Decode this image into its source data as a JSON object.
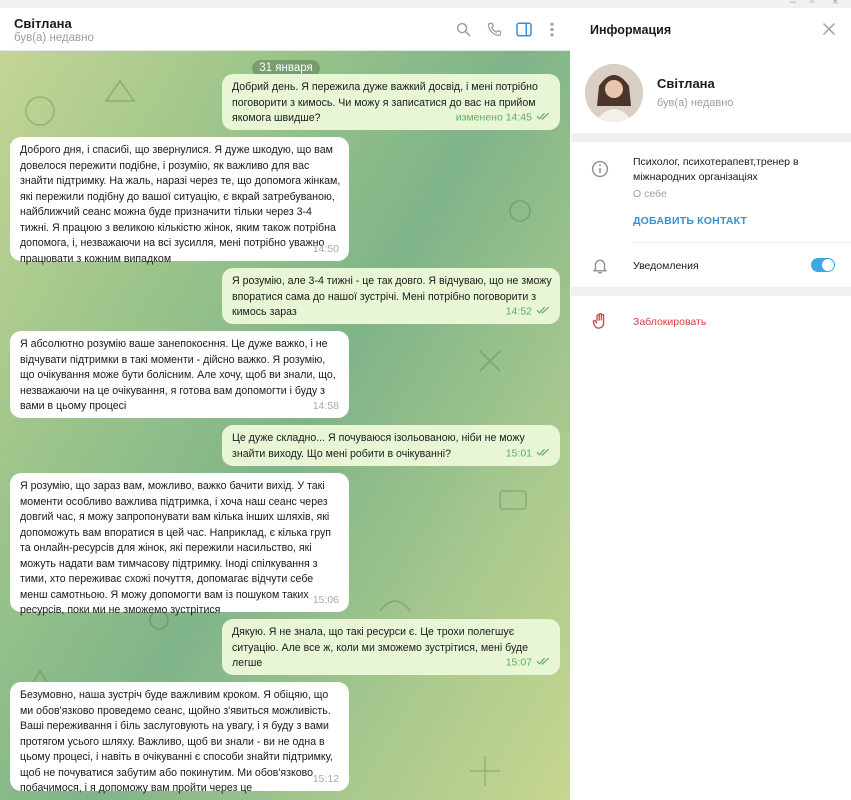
{
  "chat": {
    "contact_name": "Світлана",
    "contact_status": "був(а) недавно",
    "date_label": "31 января",
    "messages": [
      {
        "dir": "out",
        "text": "Добрий день. Я пережила дуже важкий досвід, і мені потрібно поговорити з кимось. Чи можу я записатися до вас на прийом якомога швидше?",
        "time": "изменено 14:45",
        "read": true
      },
      {
        "dir": "in",
        "text": "Доброго дня, і спасибі, що звернулися. Я дуже шкодую, що вам довелося пережити подібне, і розумію, як важливо для вас знайти підтримку. На жаль, наразі через те, що допомога жінкам, які пережили подібну до вашої ситуацію, є вкрай затребуваною, найближчий сеанс можна буде призначити тільки через 3-4 тижні. Я працюю з великою кількістю жінок, яким також потрібна допомога, і, незважаючи на всі зусилля, мені потрібно уважно працювати з кожним випадком",
        "time": "14:50"
      },
      {
        "dir": "out",
        "text": "Я розумію, але 3-4 тижні - це так довго. Я відчуваю, що не зможу впоратися сама до нашої зустрічі. Мені потрібно поговорити з кимось зараз",
        "time": "14:52",
        "read": true
      },
      {
        "dir": "in",
        "text": "Я абсолютно розумію ваше занепокоєння. Це дуже важко, і не відчувати підтримки в такі моменти - дійсно важко. Я розумію, що очікування може бути болісним. Але хочу, щоб ви знали, що, незважаючи на це очікування, я готова вам допомогти і буду з вами в цьому процесі",
        "time": "14:58"
      },
      {
        "dir": "out",
        "text": "Це дуже складно... Я почуваюся ізольованою, ніби не можу знайти виходу. Що мені робити в очікуванні?",
        "time": "15:01",
        "read": true
      },
      {
        "dir": "in",
        "text": "Я розумію, що зараз вам, можливо, важко бачити вихід. У такі моменти особливо важлива підтримка, і хоча наш сеанс через довгий час, я можу запропонувати вам кілька інших шляхів, які допоможуть вам впоратися в цей час. Наприклад, є кілька груп та онлайн-ресурсів для жінок, які пережили насильство, які можуть надати вам тимчасову підтримку. Іноді спілкування з тими, хто переживає схожі почуття, допомагає відчути себе менш самотньою. Я можу допомогти вам із пошуком таких ресурсів, поки ми не зможемо зустрітися",
        "time": "15:06"
      },
      {
        "dir": "out",
        "text": "Дякую. Я не знала, що такі ресурси є. Це трохи полегшує ситуацію. Але все ж, коли ми зможемо зустрітися, мені буде легше",
        "time": "15:07",
        "read": true
      },
      {
        "dir": "in",
        "text": "Безумовно, наша зустріч буде важливим кроком. Я обіцяю, що ми обов'язково проведемо сеанс, щойно з'явиться можливість. Ваші переживання і біль заслуговують на увагу, і я буду з вами протягом усього шляху. Важливо, щоб ви знали - ви не одна в цьому процесі, і навіть в очікуванні є способи знайти підтримку, щоб не почуватися забутим або покинутим. Ми обов'язково побачимося, і я допоможу вам пройти через це",
        "time": "15:12"
      }
    ]
  },
  "info": {
    "title": "Информация",
    "name": "Світлана",
    "status": "був(а) недавно",
    "bio": "Психолог, психотерапевт,тренер в міжнародних організаціях",
    "bio_caption": "О себе",
    "add_contact": "ДОБАВИТЬ КОНТАКТ",
    "notifications_label": "Уведомления",
    "notifications_on": true,
    "block_label": "Заблокировать"
  },
  "icons": {
    "header": [
      "search-icon",
      "phone-icon",
      "sidebar-toggle-icon",
      "more-icon"
    ],
    "info": [
      "close-icon",
      "info-icon",
      "bell-icon",
      "block-hand-icon"
    ]
  },
  "colors": {
    "accent": "#40a7e3",
    "outgoing_bubble": "#e9f6d5",
    "read_ticks": "#5fae61",
    "danger": "#d04040"
  }
}
